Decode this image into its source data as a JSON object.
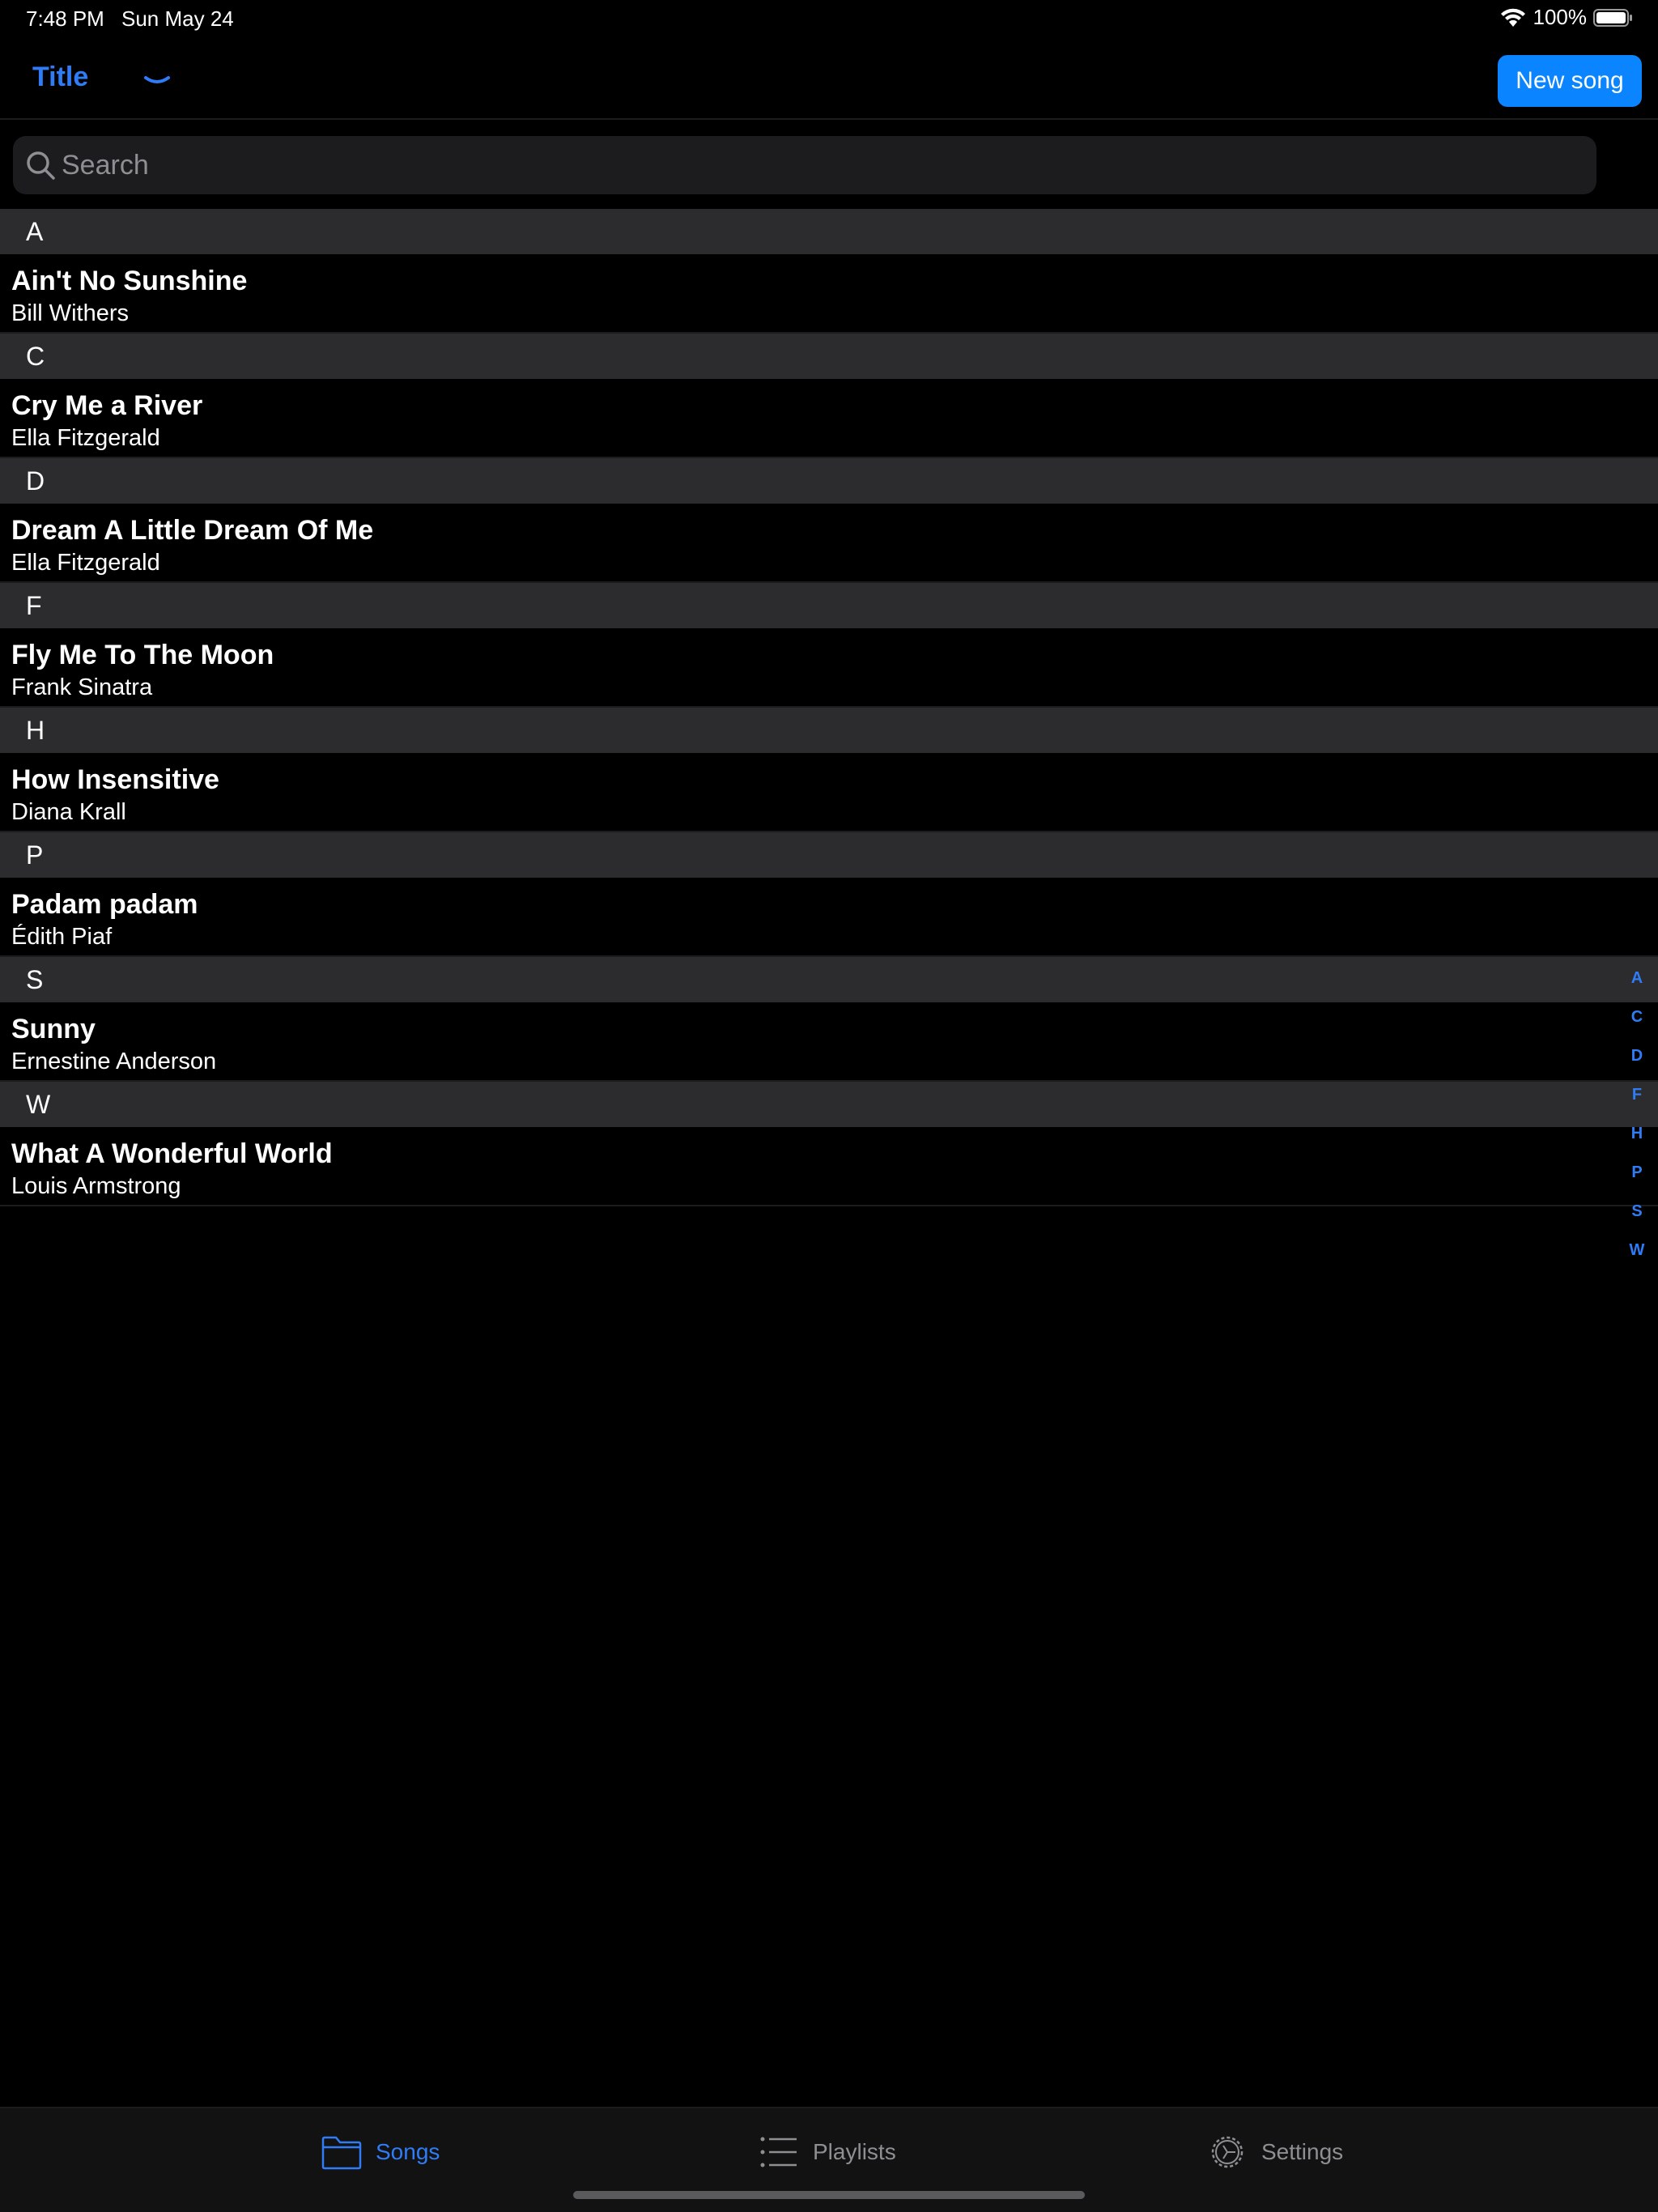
{
  "status_bar": {
    "time": "7:48 PM",
    "date": "Sun May 24",
    "battery": "100%",
    "icons": [
      "wifi-icon",
      "battery-icon"
    ]
  },
  "nav": {
    "title": "Title",
    "chevron_icon": "chevron-down-icon",
    "new_song_label": "New song"
  },
  "search": {
    "placeholder": "Search",
    "value": "",
    "icon": "search-icon"
  },
  "sections": [
    {
      "letter": "A",
      "songs": [
        {
          "title": "Ain't No Sunshine",
          "artist": "Bill Withers"
        }
      ]
    },
    {
      "letter": "C",
      "songs": [
        {
          "title": "Cry Me a River",
          "artist": "Ella Fitzgerald"
        }
      ]
    },
    {
      "letter": "D",
      "songs": [
        {
          "title": "Dream A Little Dream Of Me",
          "artist": "Ella Fitzgerald"
        }
      ]
    },
    {
      "letter": "F",
      "songs": [
        {
          "title": "Fly Me To The Moon",
          "artist": "Frank Sinatra"
        }
      ]
    },
    {
      "letter": "H",
      "songs": [
        {
          "title": "How Insensitive",
          "artist": "Diana Krall"
        }
      ]
    },
    {
      "letter": "P",
      "songs": [
        {
          "title": "Padam padam",
          "artist": "Édith Piaf"
        }
      ]
    },
    {
      "letter": "S",
      "songs": [
        {
          "title": "Sunny",
          "artist": "Ernestine Anderson"
        }
      ]
    },
    {
      "letter": "W",
      "songs": [
        {
          "title": "What A Wonderful World",
          "artist": "Louis Armstrong"
        }
      ]
    }
  ],
  "section_index": [
    "A",
    "C",
    "D",
    "F",
    "H",
    "P",
    "S",
    "W"
  ],
  "tab_bar": {
    "tabs": [
      {
        "label": "Songs",
        "icon": "folder-icon",
        "active": true
      },
      {
        "label": "Playlists",
        "icon": "list-icon",
        "active": false
      },
      {
        "label": "Settings",
        "icon": "gear-icon",
        "active": false
      }
    ]
  },
  "colors": {
    "accent": "#2f7cf6",
    "button": "#0a84ff",
    "background": "#000000",
    "section_header": "#2c2c2e",
    "inactive": "#8e8e93"
  }
}
